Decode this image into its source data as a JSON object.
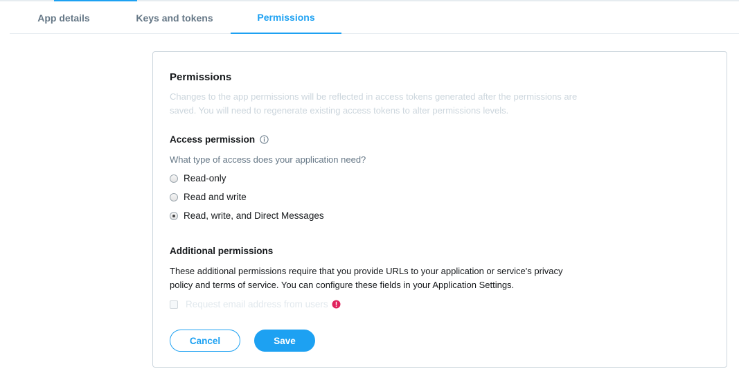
{
  "tabs": [
    {
      "label": "App details",
      "active": false
    },
    {
      "label": "Keys and tokens",
      "active": false
    },
    {
      "label": "Permissions",
      "active": true
    }
  ],
  "card": {
    "title": "Permissions",
    "description": "Changes to the app permissions will be reflected in access tokens generated after the permissions are saved. You will need to regenerate existing access tokens to alter permissions levels.",
    "access": {
      "title": "Access permission",
      "icon": "info-icon",
      "question": "What type of access does your application need?",
      "options": [
        {
          "label": "Read-only",
          "checked": false
        },
        {
          "label": "Read and write",
          "checked": false
        },
        {
          "label": "Read, write, and Direct Messages",
          "checked": true
        }
      ]
    },
    "additional": {
      "title": "Additional permissions",
      "description": "These additional permissions require that you provide URLs to your application or service's privacy policy and terms of service. You can configure these fields in your Application Settings.",
      "checkbox_label": "Request email address from users",
      "checkbox_checked": false,
      "warning_icon": "alert-icon"
    },
    "buttons": {
      "cancel": "Cancel",
      "save": "Save"
    }
  },
  "colors": {
    "accent": "#1da1f2",
    "warning": "#e0245e",
    "muted": "#ccd6dd"
  }
}
